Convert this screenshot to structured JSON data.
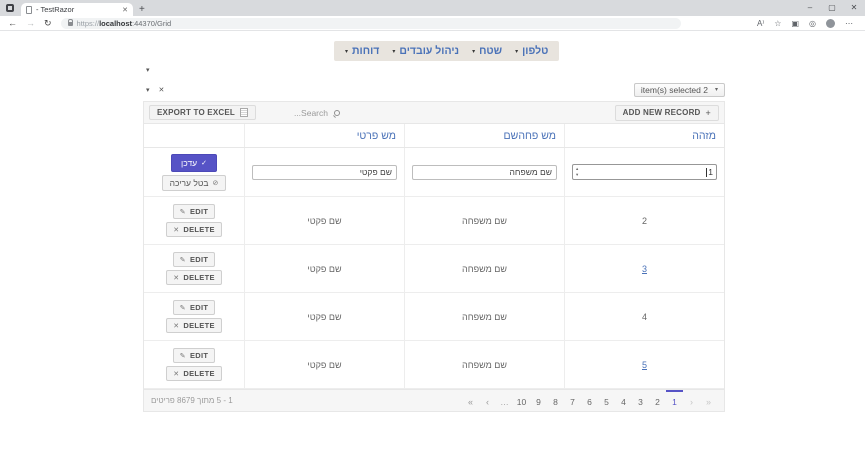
{
  "browser": {
    "tab_title": "- TestRazor",
    "url": {
      "scheme": "https://",
      "host": "localhost",
      "path": ":44370/Grid"
    },
    "icons": {
      "minimize": "–",
      "restore": "▢",
      "close": "✕",
      "tab_close": "✕",
      "new_tab": "+",
      "back": "←",
      "forward": "→",
      "refresh": "↻",
      "read_aloud": "A⁾",
      "favorites": "☆",
      "collections": "▣",
      "essentials": "◎",
      "more": "⋯"
    }
  },
  "nav": {
    "caret": "▾",
    "items": [
      {
        "label": "טלפון"
      },
      {
        "label": "שטח"
      },
      {
        "label": "ניהול עובדים"
      },
      {
        "label": "דוחות"
      }
    ]
  },
  "filter_controls": {
    "caret_top": "▾",
    "caret": "▾",
    "close": "✕"
  },
  "grid": {
    "selection_dropdown": {
      "label": "item(s) selected 2",
      "caret": "▾"
    },
    "toolbar": {
      "export_label": "EXPORT TO EXCEL",
      "search_placeholder": "Search...",
      "add_label": "ADD NEW RECORD",
      "add_icon": "+"
    },
    "columns": {
      "id": "מזהה",
      "family": "מש פחהשם",
      "first": "מש פרטי"
    },
    "edit_row": {
      "id_value": "1",
      "family_value": "שם משפחה",
      "first_value": "שם פקטי",
      "spin_up": "▴",
      "spin_down": "▾",
      "update_label": "עדכן",
      "update_icon": "✓",
      "cancel_label": "בטל עריכה",
      "cancel_icon": "⊘"
    },
    "row_buttons": {
      "edit": "EDIT",
      "edit_icon": "✎",
      "delete": "DELETE",
      "delete_icon": "✕"
    },
    "rows": [
      {
        "id": "2",
        "family": "שם משפחה",
        "first": "שם פקטי",
        "selected": false
      },
      {
        "id": "3",
        "family": "שם משפחה",
        "first": "שם פקטי",
        "selected": true
      },
      {
        "id": "4",
        "family": "שם משפחה",
        "first": "שם פקטי",
        "selected": false
      },
      {
        "id": "5",
        "family": "שם משפחה",
        "first": "שם פקטי",
        "selected": true
      }
    ],
    "pager": {
      "nav_left": [
        "«",
        "‹",
        "…"
      ],
      "pages": [
        "10",
        "9",
        "8",
        "7",
        "6",
        "5",
        "4",
        "3",
        "2",
        "1"
      ],
      "current": "1",
      "nav_right": [
        "›",
        "»"
      ],
      "info": "1 - 5 מתוך 8679 פריטים"
    }
  },
  "colors": {
    "accent_purple": "#5653c6",
    "link_blue": "#4a72b8",
    "toolbar_gray": "#f6f6f6",
    "nav_strip": "#e8e4de"
  }
}
